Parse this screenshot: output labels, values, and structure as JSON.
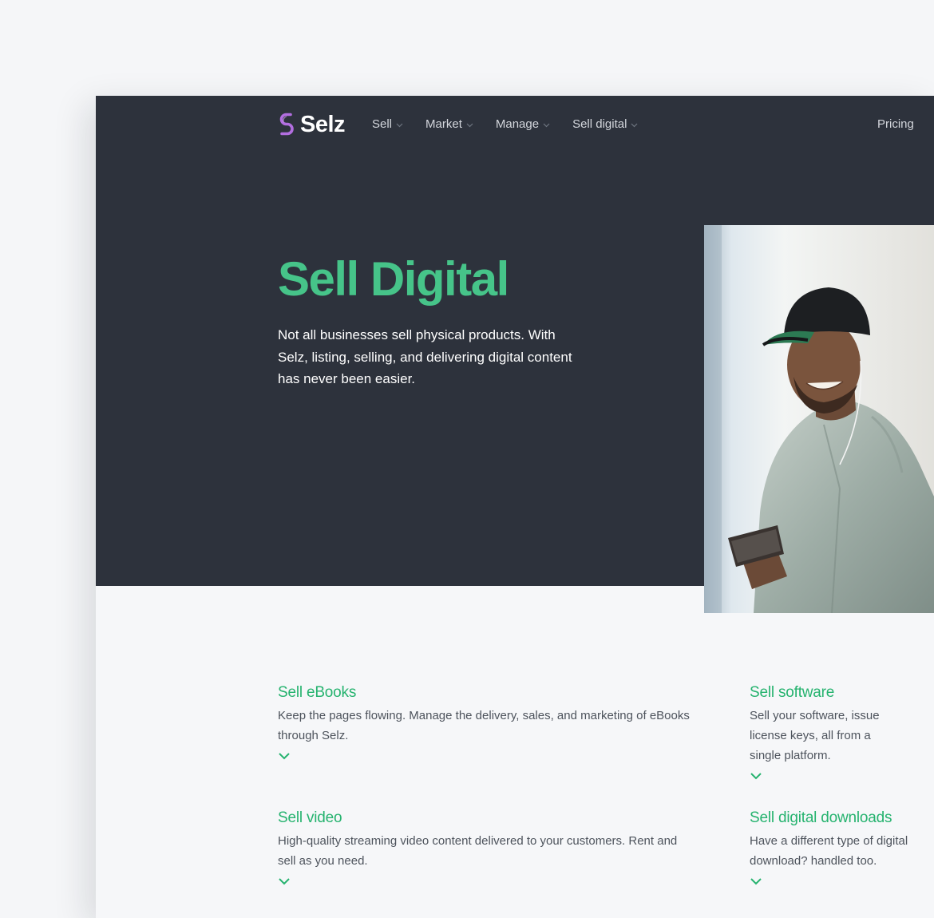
{
  "brand": {
    "name": "Selz",
    "accent": "#46c489",
    "logo_color": "#b26ee0",
    "hero_bg": "#2d323c"
  },
  "nav": {
    "items": [
      {
        "label": "Sell"
      },
      {
        "label": "Market"
      },
      {
        "label": "Manage"
      },
      {
        "label": "Sell digital"
      }
    ],
    "pricing": "Pricing"
  },
  "hero": {
    "title": "Sell Digital",
    "description": "Not all businesses sell physical products. With Selz, listing, selling, and delivering digital content has never been easier."
  },
  "features": [
    {
      "title": "Sell eBooks",
      "description": "Keep the pages flowing. Manage the delivery, sales, and marketing of eBooks through Selz.",
      "icon": "chevron-down-icon"
    },
    {
      "title": "Sell software",
      "description": "Sell your software, issue license keys, all from a single platform.",
      "icon": "chevron-down-icon"
    },
    {
      "title": "Sell video",
      "description": "High-quality streaming video content delivered to your customers. Rent and sell as you need.",
      "icon": "chevron-down-icon"
    },
    {
      "title": "Sell digital downloads",
      "description": "Have a different type of digital download? handled too.",
      "icon": "chevron-down-icon"
    }
  ]
}
